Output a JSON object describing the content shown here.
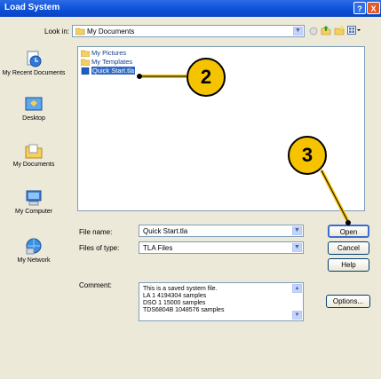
{
  "window": {
    "title": "Load System",
    "help_glyph": "?",
    "close_glyph": "X"
  },
  "toolbar": {
    "look_in_label": "Look in:",
    "look_in_value": "My Documents",
    "icons": [
      "back-icon",
      "up-folder-icon",
      "new-folder-icon",
      "views-menu-icon"
    ]
  },
  "places": [
    {
      "label": "My Recent Documents",
      "icon": "recent-documents-icon"
    },
    {
      "label": "Desktop",
      "icon": "desktop-icon"
    },
    {
      "label": "My Documents",
      "icon": "my-documents-icon"
    },
    {
      "label": "My Computer",
      "icon": "my-computer-icon"
    },
    {
      "label": "My Network",
      "icon": "my-network-icon"
    }
  ],
  "files": [
    {
      "name": "My Pictures",
      "type": "folder"
    },
    {
      "name": "My Templates",
      "type": "folder"
    },
    {
      "name": "Quick Start.tla",
      "type": "file",
      "selected": true
    }
  ],
  "form": {
    "file_name_label": "File name:",
    "file_name_value": "Quick Start.tla",
    "files_of_type_label": "Files of type:",
    "files_of_type_value": "TLA Files",
    "comment_label": "Comment:",
    "comment_lines": [
      "This is a saved system file.",
      "LA 1   4194304 samples",
      "DSO 1   15000 samples",
      "TDS6804B   1048576 samples"
    ]
  },
  "buttons": {
    "open": "Open",
    "cancel": "Cancel",
    "help": "Help",
    "options": "Options..."
  },
  "callouts": {
    "two": "2",
    "three": "3"
  },
  "colors": {
    "titlebar": "#0a4fd6",
    "dialog_bg": "#ece9d8",
    "selection": "#316ac5",
    "callout": "#f6c300"
  }
}
